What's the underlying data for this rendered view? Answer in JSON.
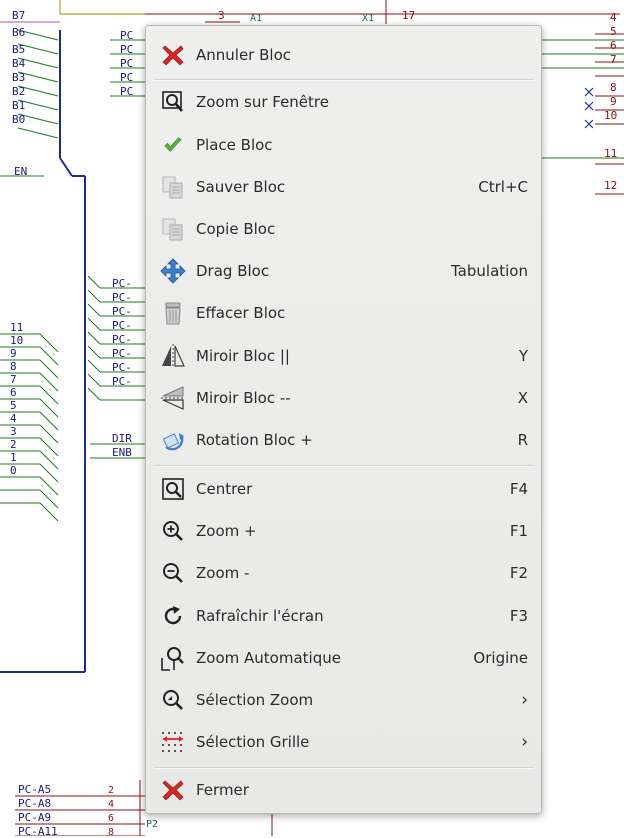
{
  "schematic": {
    "bus_pins_top": [
      "B7",
      "B6",
      "B5",
      "B4",
      "B3",
      "B2",
      "B1",
      "B0"
    ],
    "en_label": "EN",
    "pc_labels_top": [
      "PC",
      "PC",
      "PC",
      "PC",
      "PC"
    ],
    "pc_labels_mid": [
      "PC-",
      "PC-",
      "PC-",
      "PC-",
      "PC-",
      "PC-",
      "PC-",
      "PC-"
    ],
    "addr_pins": [
      "11",
      "10",
      "9",
      "8",
      "7",
      "6",
      "5",
      "4",
      "3",
      "2",
      "1",
      "0"
    ],
    "dir_label": "DIR",
    "enb_label": "ENB",
    "bottom_labels": [
      "PC-A5",
      "PC-A8",
      "PC-A9",
      "PC-A11"
    ],
    "bottom_pin_nums": [
      "2",
      "4",
      "6",
      "8"
    ],
    "p2_label": "P2",
    "top_pin_3": "3",
    "top_ref": "A1",
    "top_ref2": "X1",
    "top_pin_17": "17",
    "right_pins": [
      "4",
      "5",
      "6",
      "7",
      "8",
      "9",
      "10",
      "11",
      "12"
    ]
  },
  "menu": {
    "items": [
      {
        "label": "Annuler Bloc",
        "shortcut": "",
        "icon": "red-x-icon"
      },
      {
        "label": "Zoom sur Fenêtre",
        "shortcut": "",
        "icon": "zoom-window-icon"
      },
      {
        "label": "Place Bloc",
        "shortcut": "",
        "icon": "green-check-icon"
      },
      {
        "label": "Sauver Bloc",
        "shortcut": "Ctrl+C",
        "icon": "copy-pages-icon"
      },
      {
        "label": "Copie Bloc",
        "shortcut": "",
        "icon": "copy-pages-icon"
      },
      {
        "label": "Drag Bloc",
        "shortcut": "Tabulation",
        "icon": "move-arrows-icon"
      },
      {
        "label": "Effacer Bloc",
        "shortcut": "",
        "icon": "trash-icon"
      },
      {
        "label": "Miroir Bloc ||",
        "shortcut": "Y",
        "icon": "mirror-vertical-icon"
      },
      {
        "label": "Miroir Bloc --",
        "shortcut": "X",
        "icon": "mirror-horizontal-icon"
      },
      {
        "label": "Rotation Bloc +",
        "shortcut": "R",
        "icon": "rotate-icon"
      },
      {
        "label": "Centrer",
        "shortcut": "F4",
        "icon": "center-zoom-icon"
      },
      {
        "label": "Zoom +",
        "shortcut": "F1",
        "icon": "zoom-in-icon"
      },
      {
        "label": "Zoom -",
        "shortcut": "F2",
        "icon": "zoom-out-icon"
      },
      {
        "label": "Rafraîchir l'écran",
        "shortcut": "F3",
        "icon": "refresh-icon"
      },
      {
        "label": "Zoom Automatique",
        "shortcut": "Origine",
        "icon": "zoom-auto-icon"
      },
      {
        "label": "Sélection Zoom",
        "shortcut": "›",
        "icon": "zoom-select-icon"
      },
      {
        "label": "Sélection Grille",
        "shortcut": "›",
        "icon": "grid-icon"
      },
      {
        "label": "Fermer",
        "shortcut": "",
        "icon": "red-x-icon"
      }
    ]
  }
}
